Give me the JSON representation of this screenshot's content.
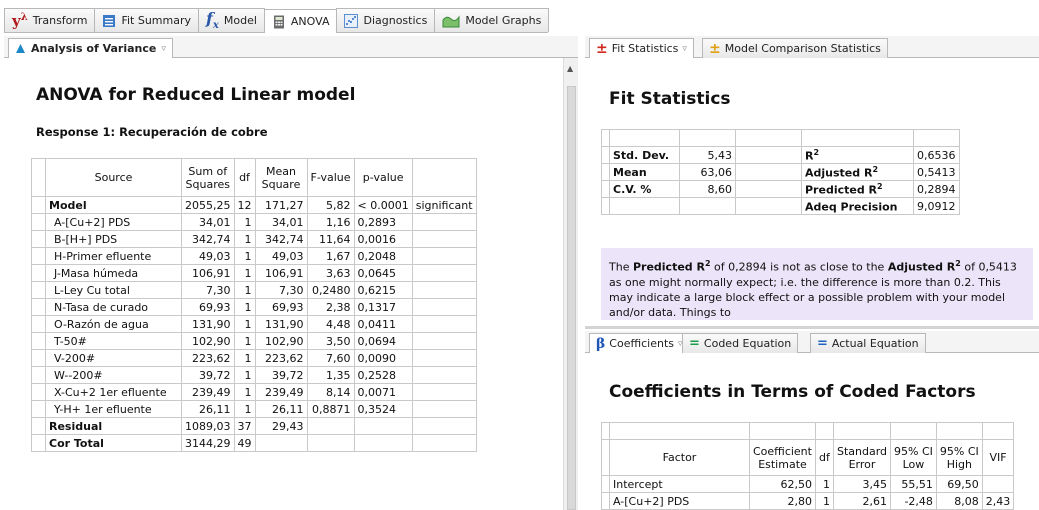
{
  "top_tabs": [
    {
      "label": "Transform",
      "icon": "transform-icon"
    },
    {
      "label": "Fit Summary",
      "icon": "fit-summary-icon"
    },
    {
      "label": "Model",
      "icon": "fx-icon"
    },
    {
      "label": "ANOVA",
      "icon": "calculator-icon"
    },
    {
      "label": "Diagnostics",
      "icon": "diagnostics-icon"
    },
    {
      "label": "Model Graphs",
      "icon": "model-graphs-icon"
    }
  ],
  "transform_icon_glyph": "y",
  "transform_icon_sup": "λ",
  "fx_icon_glyph": "f",
  "fx_icon_sub": "x",
  "left_panel": {
    "tab_label": "Analysis of Variance",
    "title": "ANOVA for Reduced Linear model",
    "response": "Response 1: Recuperación de cobre",
    "headers": {
      "source": "Source",
      "sum_of_squares_1": "Sum of",
      "sum_of_squares_2": "Squares",
      "df": "df",
      "mean_square_1": "Mean",
      "mean_square_2": "Square",
      "f_value": "F-value",
      "p_value": "p-value"
    },
    "rows": [
      {
        "source": "Model",
        "ss": "2055,25",
        "df": "12",
        "ms": "171,27",
        "f": "5,82",
        "p": "< 0.0001",
        "note": "significant",
        "bold": true
      },
      {
        "source": "A-[Cu+2] PDS",
        "ss": "34,01",
        "df": "1",
        "ms": "34,01",
        "f": "1,16",
        "p": "0,2893",
        "note": ""
      },
      {
        "source": "B-[H+] PDS",
        "ss": "342,74",
        "df": "1",
        "ms": "342,74",
        "f": "11,64",
        "p": "0,0016",
        "note": ""
      },
      {
        "source": "H-Primer efluente",
        "ss": "49,03",
        "df": "1",
        "ms": "49,03",
        "f": "1,67",
        "p": "0,2048",
        "note": ""
      },
      {
        "source": "J-Masa húmeda",
        "ss": "106,91",
        "df": "1",
        "ms": "106,91",
        "f": "3,63",
        "p": "0,0645",
        "note": ""
      },
      {
        "source": "L-Ley Cu total",
        "ss": "7,30",
        "df": "1",
        "ms": "7,30",
        "f": "0,2480",
        "p": "0,6215",
        "note": ""
      },
      {
        "source": "N-Tasa de curado",
        "ss": "69,93",
        "df": "1",
        "ms": "69,93",
        "f": "2,38",
        "p": "0,1317",
        "note": ""
      },
      {
        "source": "O-Razón de agua",
        "ss": "131,90",
        "df": "1",
        "ms": "131,90",
        "f": "4,48",
        "p": "0,0411",
        "note": ""
      },
      {
        "source": "T-50#",
        "ss": "102,90",
        "df": "1",
        "ms": "102,90",
        "f": "3,50",
        "p": "0,0694",
        "note": ""
      },
      {
        "source": "V-200#",
        "ss": "223,62",
        "df": "1",
        "ms": "223,62",
        "f": "7,60",
        "p": "0,0090",
        "note": ""
      },
      {
        "source": "W--200#",
        "ss": "39,72",
        "df": "1",
        "ms": "39,72",
        "f": "1,35",
        "p": "0,2528",
        "note": ""
      },
      {
        "source": "X-Cu+2 1er efluente",
        "ss": "239,49",
        "df": "1",
        "ms": "239,49",
        "f": "8,14",
        "p": "0,0071",
        "note": ""
      },
      {
        "source": "Y-H+ 1er efluente",
        "ss": "26,11",
        "df": "1",
        "ms": "26,11",
        "f": "0,8871",
        "p": "0,3524",
        "note": ""
      },
      {
        "source": "Residual",
        "ss": "1089,03",
        "df": "37",
        "ms": "29,43",
        "f": "",
        "p": "",
        "note": "",
        "bold": true
      },
      {
        "source": "Cor Total",
        "ss": "3144,29",
        "df": "49",
        "ms": "",
        "f": "",
        "p": "",
        "note": "",
        "bold": true
      }
    ]
  },
  "fit_panel": {
    "tabs": [
      "Fit Statistics",
      "Model Comparison Statistics"
    ],
    "title": "Fit Statistics",
    "rows": [
      {
        "l1": "Std. Dev.",
        "v1": "5,43",
        "l2_main": "R",
        "l2_sup": "2",
        "l2_rest": "",
        "v2": "0,6536"
      },
      {
        "l1": "Mean",
        "v1": "63,06",
        "l2_main": "Adjusted R",
        "l2_sup": "2",
        "l2_rest": "",
        "v2": "0,5413"
      },
      {
        "l1": "C.V. %",
        "v1": "8,60",
        "l2_main": "Predicted R",
        "l2_sup": "2",
        "l2_rest": "",
        "v2": "0,2894"
      },
      {
        "l1": "",
        "v1": "",
        "l2_main": "Adeq Precision",
        "l2_sup": "",
        "l2_rest": "",
        "v2": "9,0912"
      }
    ],
    "note": {
      "p1": "The ",
      "b1": "Predicted R",
      "s1": "2",
      "p2": " of 0,2894 is not as close to the ",
      "b2": "Adjusted R",
      "s2": "2",
      "p3": " of 0,5413 as one might normally expect; i.e. the difference is more than 0.2. This may indicate a large block effect or a possible problem with your model and/or data. Things to"
    }
  },
  "coef_panel": {
    "tabs": [
      "Coefficients",
      "Coded Equation",
      "Actual Equation"
    ],
    "title": "Coefficients in Terms of Coded Factors",
    "headers": {
      "factor": "Factor",
      "coef_1": "Coefficient",
      "coef_2": "Estimate",
      "df": "df",
      "se_1": "Standard",
      "se_2": "Error",
      "low_1": "95% CI",
      "low_2": "Low",
      "high_1": "95% CI",
      "high_2": "High",
      "vif": "VIF"
    },
    "rows": [
      {
        "factor": "Intercept",
        "coef": "62,50",
        "df": "1",
        "se": "3,45",
        "low": "55,51",
        "high": "69,50",
        "vif": ""
      },
      {
        "factor": "A-[Cu+2] PDS",
        "coef": "2,80",
        "df": "1",
        "se": "2,61",
        "low": "-2,48",
        "high": "8,08",
        "vif": "2,43"
      }
    ]
  }
}
